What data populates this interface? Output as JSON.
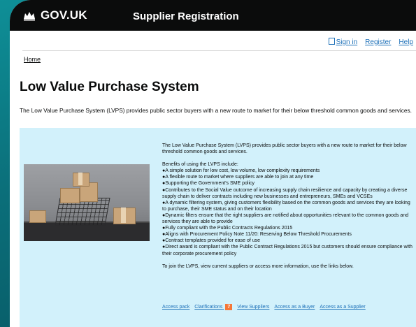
{
  "header": {
    "logo_text": "GOV.UK",
    "service_name": "Supplier Registration"
  },
  "toplinks": {
    "sign_in": "Sign in",
    "register": "Register",
    "help": "Help"
  },
  "breadcrumb": "Home",
  "page_title": "Low Value Purchase System",
  "intro": "The Low Value Purchase System (LVPS) provides public sector buyers with a new route to market for their below threshold common goods and services.",
  "panel": {
    "lead": "The Low Value Purchase System (LVPS) provides public sector buyers with a new route to market for their below threshold common goods and services.",
    "benefits_heading": "Benefits of using the LVPS include:",
    "benefits": [
      "●A simple solution for low cost, low volume, low complexity requirements",
      "●A flexible route to market where suppliers are able to join at any time",
      "●Supporting the Government's SME policy",
      "●Contributes to the Social Value outcome of increasing supply chain resilience and capacity by creating a diverse supply chain to deliver contracts including new businesses and entrepreneurs, SMEs and VCSEs",
      "●A dynamic filtering system, giving customers flexibility based on the common goods and services they are looking to purchase, their SME status and on their location",
      "●Dynamic filters ensure that the right suppliers are notified about opportunities relevant to the common goods and services they are able to provide",
      "●Fully compliant with the Public Contracts Regulations 2015",
      "●Aligns with Procurement Policy Note 11/20: Reserving Below Threshold Procurements",
      "●Contract templates provided for ease of use",
      "●Direct award is compliant with the Public Contract Regulations 2015 but customers should ensure compliance with their corporate procurement policy"
    ],
    "closing": "To join the LVPS, view current suppliers or access more information, use the links below.",
    "links": {
      "access_pack": "Access pack",
      "clarifications": "Clarifications",
      "clarifications_count": "7",
      "view_suppliers": "View Suppliers",
      "access_buyer": "Access as a Buyer",
      "access_supplier": "Access as a Supplier"
    }
  },
  "colors": {
    "header_bg": "#0b0c0c",
    "link": "#1d70b8",
    "panel_bg": "#d2f1fb",
    "badge": "#f47738"
  }
}
